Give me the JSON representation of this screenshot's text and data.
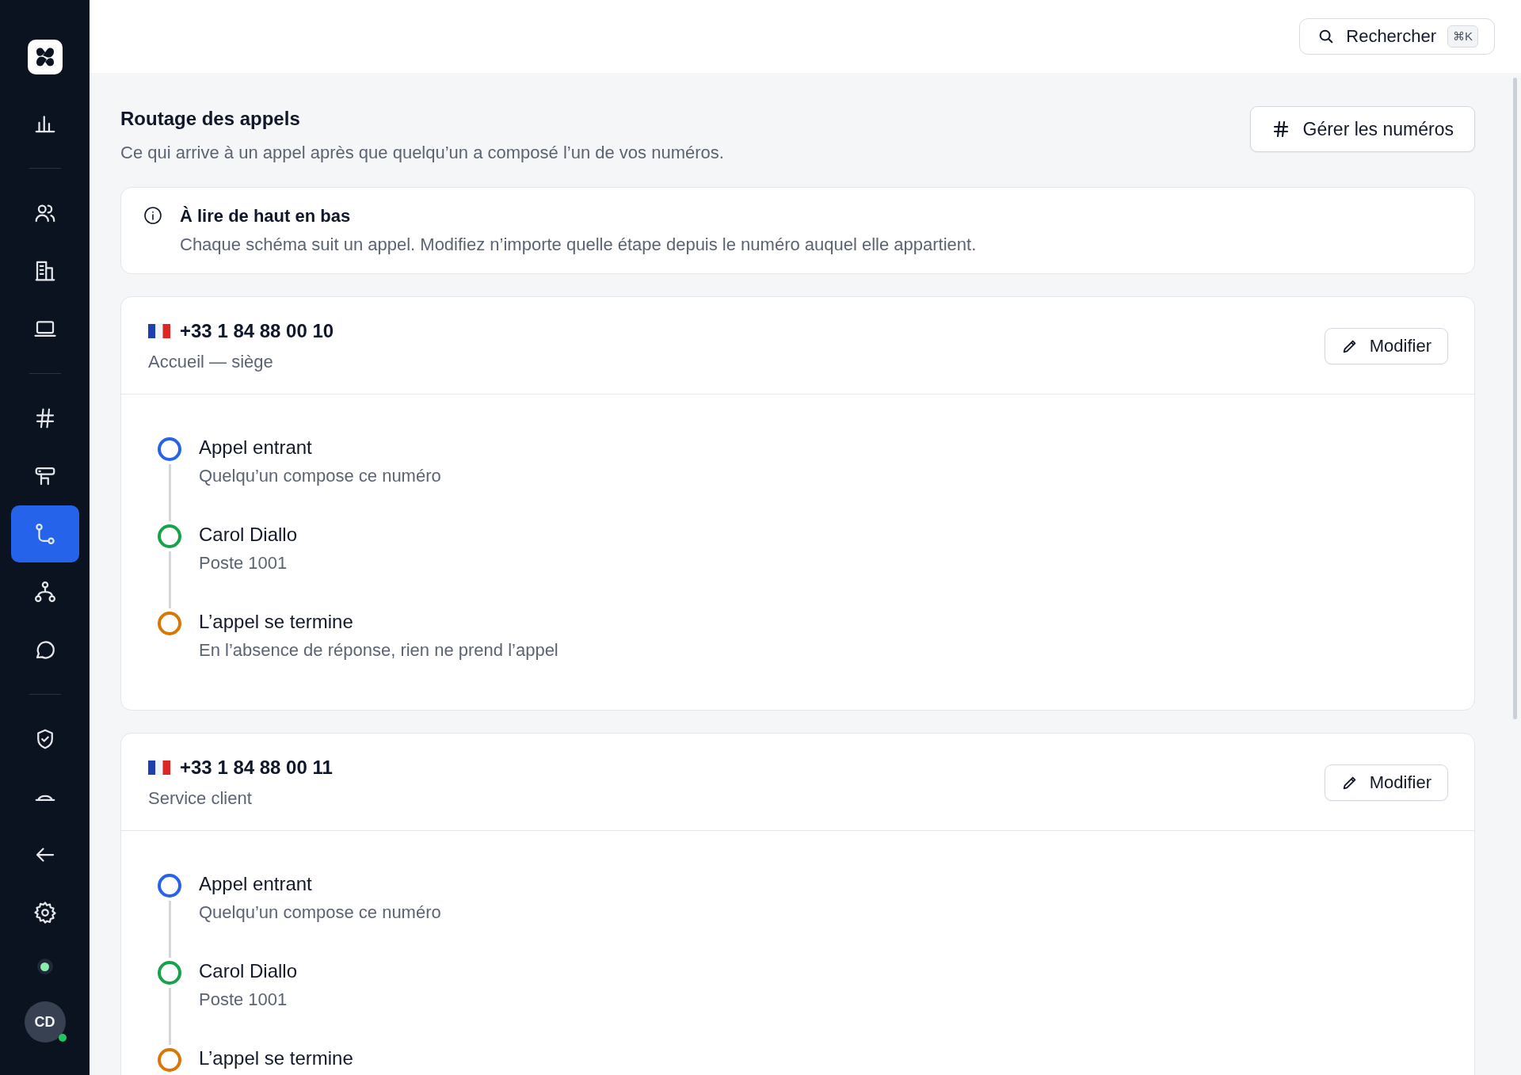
{
  "sidebar": {
    "groups": [
      [
        {
          "selected": false
        }
      ],
      [
        {
          "selected": false
        },
        {
          "selected": false
        },
        {
          "selected": false
        }
      ],
      [
        {
          "selected": false
        },
        {
          "selected": false
        },
        {
          "selected": true
        },
        {
          "selected": false
        },
        {
          "selected": false
        }
      ],
      [
        {
          "selected": false
        },
        {
          "selected": false
        },
        {
          "selected": false
        },
        {
          "selected": false
        }
      ]
    ],
    "status": {
      "online": true
    },
    "avatar": {
      "initials": "CD",
      "online": true
    }
  },
  "topbar": {
    "search": {
      "label": "Rechercher",
      "shortcut": "⌘K"
    }
  },
  "page": {
    "title": "Routage des appels",
    "subtitle": "Ce qui arrive à un appel après que quelqu’un a composé l’un de vos numéros.",
    "action": "Gérer les numéros"
  },
  "info": {
    "title": "À lire de haut en bas",
    "text": "Chaque schéma suit un appel. Modifiez n’importe quelle étape depuis le numéro auquel elle appartient."
  },
  "numbers": [
    {
      "number": "+33 1 84 88 00 10",
      "name": "Accueil — siège",
      "edit": "Modifier",
      "steps": [
        {
          "title": "Appel entrant",
          "subtitle": "Quelqu’un compose ce numéro",
          "color": "#2563eb"
        },
        {
          "title": "Carol Diallo",
          "subtitle": "Poste 1001",
          "color": "#16a34a"
        },
        {
          "title": "L’appel se termine",
          "subtitle": "En l’absence de réponse, rien ne prend l’appel",
          "color": "#d97706"
        }
      ]
    },
    {
      "number": "+33 1 84 88 00 11",
      "name": "Service client",
      "edit": "Modifier",
      "steps": [
        {
          "title": "Appel entrant",
          "subtitle": "Quelqu’un compose ce numéro",
          "color": "#2563eb"
        },
        {
          "title": "Carol Diallo",
          "subtitle": "Poste 1001",
          "color": "#16a34a"
        },
        {
          "title": "L’appel se termine",
          "color": "#d97706"
        }
      ]
    }
  ]
}
